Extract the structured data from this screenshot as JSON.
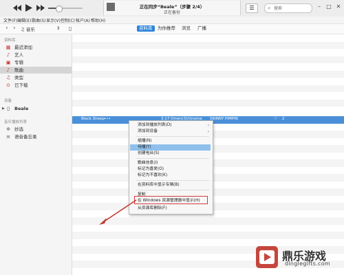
{
  "player": {
    "rewind_icon": "rewind-icon",
    "play_icon": "play-icon",
    "forward_icon": "fast-forward-icon",
    "volume_level": 0.3
  },
  "status": {
    "title": "正在同步“Beale”（步骤 2/4）",
    "subtitle": "正在备份"
  },
  "search": {
    "placeholder": "搜索"
  },
  "menubar": [
    "文件(F)",
    "编辑(E)",
    "歌曲(S)",
    "显示(V)",
    "控制(C)",
    "帐户(A)",
    "帮助(H)"
  ],
  "nav": {
    "source_selector": "音乐",
    "tabs": [
      {
        "label": "资料库",
        "active": true
      },
      {
        "label": "为你推荐",
        "active": false
      },
      {
        "label": "浏览",
        "active": false
      },
      {
        "label": "广播",
        "active": false
      }
    ]
  },
  "sidebar": {
    "library_header": "资料库",
    "library_items": [
      {
        "label": "最近添加",
        "icon": "recently-added-icon"
      },
      {
        "label": "艺人",
        "icon": "artist-icon"
      },
      {
        "label": "专辑",
        "icon": "album-icon"
      },
      {
        "label": "歌曲",
        "icon": "song-note-icon",
        "selected": true
      },
      {
        "label": "类型",
        "icon": "genre-icon"
      },
      {
        "label": "已下载",
        "icon": "download-icon"
      }
    ],
    "devices_header": "设备",
    "device": "Beale",
    "playlists_header": "音乐播放列表",
    "playlist_items": [
      {
        "label": "妙选",
        "icon": "genius-icon"
      },
      {
        "label": "语音备忘录",
        "icon": "voice-memo-icon"
      }
    ]
  },
  "songs": {
    "selected_row": {
      "title": "Black Sheep",
      "more": "•••",
      "time": "3:17",
      "artist": "Omen(3)/Unoma",
      "album": "SKINNY PIMPIN",
      "plays": "2"
    }
  },
  "context_menu": {
    "items": [
      {
        "label": "添加到播放列表(D)",
        "submenu": true
      },
      {
        "label": "添加到设备",
        "submenu": true
      },
      {
        "label": "插播(N)"
      },
      {
        "label": "待播(Y)",
        "highlighted": true
      },
      {
        "label": "创建电台(S)"
      },
      {
        "label": "歌曲信息(I)"
      },
      {
        "label": "标记为喜爱(O)"
      },
      {
        "label": "标记为不喜欢(K)"
      },
      {
        "label": "在资料库中显示专辑(B)"
      },
      {
        "label": "复制"
      },
      {
        "label": "在 Windows 资源管理器中显示(H)",
        "boxed": true
      },
      {
        "label": "从资源库删除(F)"
      }
    ]
  },
  "watermark": {
    "name": "鼎乐游戏",
    "url": "dinglegifts.com"
  },
  "colors": {
    "accent": "#2a84db",
    "selection": "#4a90d9",
    "highlight": "#8fc0ec",
    "annotation": "#d23a3a"
  }
}
